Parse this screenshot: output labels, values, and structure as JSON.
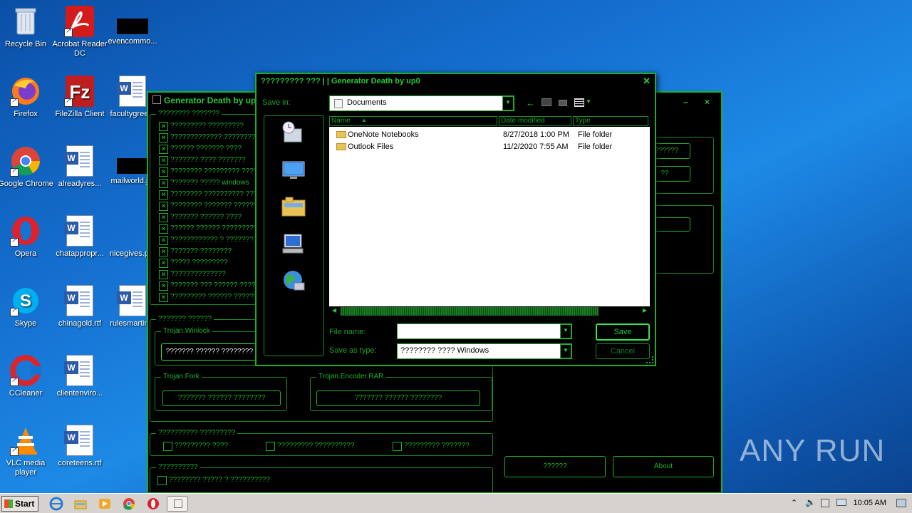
{
  "desktop": {
    "icons": [
      {
        "label": "Recycle Bin"
      },
      {
        "label": "Acrobat Reader DC"
      },
      {
        "label": "evencommo..."
      },
      {
        "label": "Firefox"
      },
      {
        "label": "FileZilla Client"
      },
      {
        "label": "facultygree..."
      },
      {
        "label": "Google Chrome"
      },
      {
        "label": "alreadyres..."
      },
      {
        "label": "mailworld.j..."
      },
      {
        "label": "Opera"
      },
      {
        "label": "chatappropr..."
      },
      {
        "label": "nicegives.p..."
      },
      {
        "label": "Skype"
      },
      {
        "label": "chinagold.rtf"
      },
      {
        "label": "rulesmartin..."
      },
      {
        "label": "CCleaner"
      },
      {
        "label": "clientenviro..."
      },
      {
        "label": "VLC media player"
      },
      {
        "label": "coreteens.rtf"
      }
    ]
  },
  "app": {
    "title": "Generator Death by up0",
    "group1_label": "???????? ???????",
    "checks": [
      "????????? ?????????",
      "????????????? ?????????",
      "?????? ??????? ????",
      "??????? ???? ???????",
      "???????? ????????? ???????",
      "??????? ????? windows",
      "???????? ?????????? ????",
      "???????? ??????? ?????? ???",
      "??????? ?????? ????",
      "?????? ?????? ??????????",
      "???????????? ? ???????",
      "??????? ????????",
      "????? ?????????",
      "??????????????",
      "??????? ??? ?????? ????",
      "????????? ?????? ????????"
    ],
    "group2_label": "??????? ??????",
    "winlock_label": "Trojan.Winlock",
    "winlock_btn": "??????? ?????? ????????",
    "fork_label": "Trojan.Fork",
    "fork_btn": "??????? ?????? ????????",
    "encoder_label": "Trojan.Encoder.RAR",
    "encoder_btn": "??????? ?????? ????????",
    "group3_label": "?????????? ?????????",
    "opts": [
      "????????? ????",
      "????????? ??????????",
      "????????? ???????"
    ],
    "group4_label": "??????????",
    "opt4": "???????? ????? ? ??????????",
    "right_btn1": "???????",
    "right_btn2": "??",
    "bottom_btn1": "??????",
    "bottom_btn2": "About",
    "controls": "– ×"
  },
  "dialog": {
    "title": "????????? ??? | | Generator Death by up0",
    "save_in_label": "Save in:",
    "save_in_value": "Documents",
    "columns": [
      "Name",
      "Date modified",
      "Type"
    ],
    "rows": [
      {
        "name": "OneNote Notebooks",
        "date": "8/27/2018 1:00 PM",
        "type": "File folder"
      },
      {
        "name": "Outlook Files",
        "date": "11/2/2020 7:55 AM",
        "type": "File folder"
      }
    ],
    "file_name_label": "File name:",
    "file_name_value": "",
    "save_type_label": "Save as type:",
    "save_type_value": "???????? ???? Windows",
    "save_btn": "Save",
    "cancel_btn": "Cancel"
  },
  "taskbar": {
    "start": "Start",
    "clock": "10:05 AM"
  },
  "watermark": "ANY RUN"
}
